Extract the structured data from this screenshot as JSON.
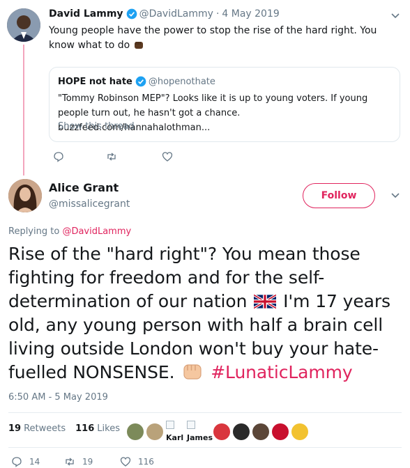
{
  "parent_tweet": {
    "name": "David Lammy",
    "handle": "@DavidLammy",
    "separator": "·",
    "date": "4 May 2019",
    "text": "Young people have the power to stop the rise of the hard right. You know what to do",
    "quoted": {
      "name": "HOPE not hate",
      "handle": "@hopenothate",
      "text": "\"Tommy Robinson MEP\"? Looks like it is up to young voters. If young people turn out, he hasn't got a chance. buzzfeed.com/hannahalothman...",
      "show_thread": "Show this thread"
    },
    "actions": [
      {
        "icon": "reply-icon"
      },
      {
        "icon": "retweet-icon"
      },
      {
        "icon": "like-icon"
      }
    ]
  },
  "main_tweet": {
    "name": "Alice Grant",
    "handle": "@missalicegrant",
    "follow_label": "Follow",
    "replying_prefix": "Replying to",
    "replying_to": "@DavidLammy",
    "text_part1": "Rise of the \"hard right\"? You mean those fighting for freedom and for the self-determination of our nation",
    "text_part2": "I'm 17 years old, any young person with half a brain cell living outside London won't buy your hate-fuelled NONSENSE.",
    "hashtag": "#LunaticLammy",
    "timestamp": "6:50 AM - 5 May 2019",
    "stats": {
      "retweets_count": "19",
      "retweets_label": "Retweets",
      "likes_count": "116",
      "likes_label": "Likes"
    },
    "likers": [
      {
        "kind": "avatar",
        "color": "#7c8a5a"
      },
      {
        "kind": "avatar",
        "color": "#b9a27a"
      },
      {
        "kind": "broken",
        "label": "Karl"
      },
      {
        "kind": "broken",
        "label": "James"
      },
      {
        "kind": "avatar",
        "color": "#d9363e"
      },
      {
        "kind": "avatar",
        "color": "#2a2a2a"
      },
      {
        "kind": "avatar",
        "color": "#5b4638"
      },
      {
        "kind": "avatar",
        "color": "#c8102e"
      },
      {
        "kind": "avatar",
        "color": "#f2c230"
      }
    ],
    "actions": {
      "reply_count": "14",
      "retweet_count": "19",
      "like_count": "116"
    }
  },
  "colors": {
    "accent": "#e0245e",
    "verified": "#1da1f2",
    "muted": "#657786",
    "thread_line": "#f3a5bd"
  }
}
